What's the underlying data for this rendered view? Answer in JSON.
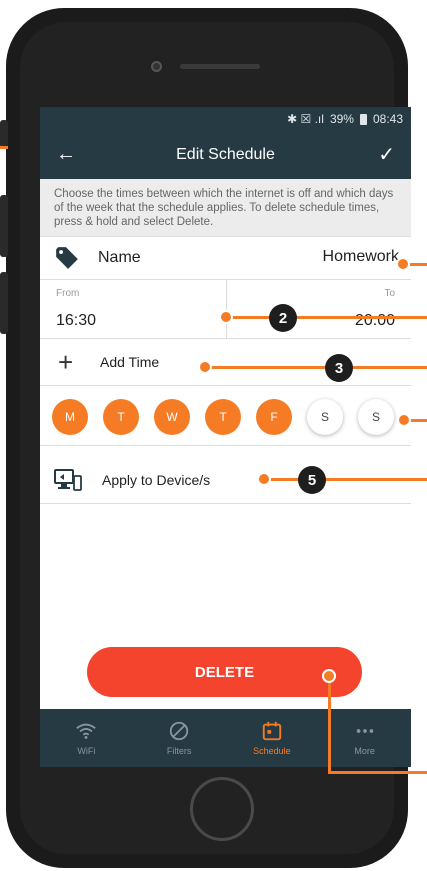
{
  "status_bar": {
    "icons": "✱ ☒ .ıl",
    "battery": "39%",
    "time": "08:43"
  },
  "header": {
    "title": "Edit Schedule",
    "back_icon": "←",
    "done_icon": "✓"
  },
  "info_text": "Choose the times between which the internet is off and which days of the week that the schedule applies. To delete schedule times, press & hold and select Delete.",
  "name": {
    "label": "Name",
    "value": "Homework"
  },
  "time_range": {
    "from_label": "From",
    "from_value": "16:30",
    "to_label": "To",
    "to_value": "20:00"
  },
  "add_time": {
    "icon": "+",
    "label": "Add Time"
  },
  "days": [
    {
      "label": "M",
      "selected": true
    },
    {
      "label": "T",
      "selected": true
    },
    {
      "label": "W",
      "selected": true
    },
    {
      "label": "T",
      "selected": true
    },
    {
      "label": "F",
      "selected": true
    },
    {
      "label": "S",
      "selected": false
    },
    {
      "label": "S",
      "selected": false
    }
  ],
  "apply": {
    "label": "Apply to Device/s"
  },
  "delete_label": "DELETE",
  "tabs": [
    {
      "label": "WiFi",
      "active": false
    },
    {
      "label": "Filters",
      "active": false
    },
    {
      "label": "Schedule",
      "active": true
    },
    {
      "label": "More",
      "active": false
    }
  ],
  "annotations": {
    "m2": "2",
    "m3": "3",
    "m5": "5"
  },
  "colors": {
    "accent": "#f57c24",
    "header": "#263a44",
    "delete": "#f5442d"
  }
}
